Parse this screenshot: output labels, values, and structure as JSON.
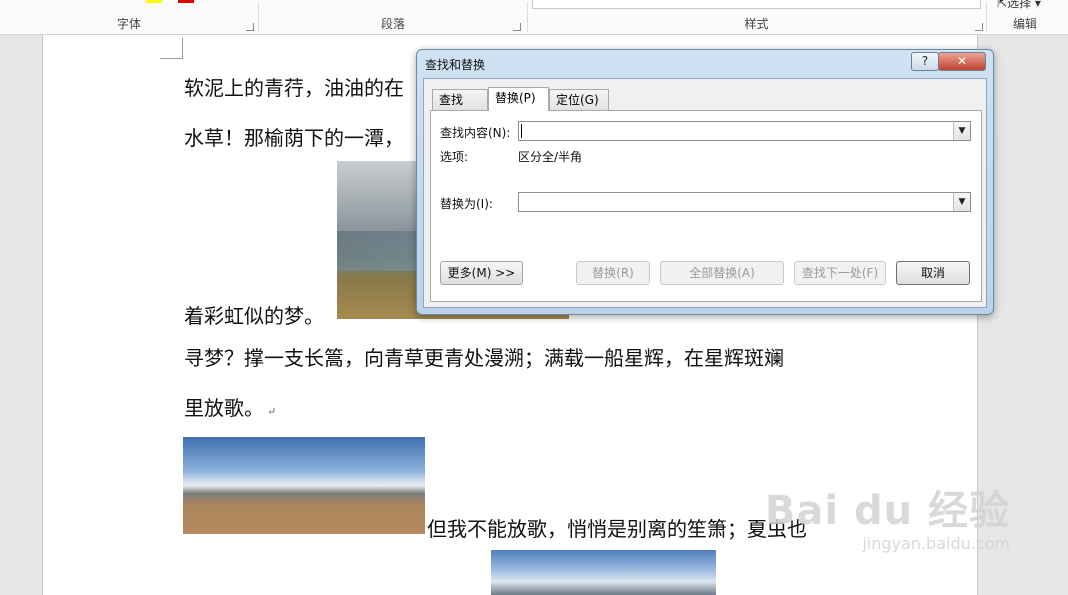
{
  "ribbon": {
    "groups": {
      "font": "字体",
      "paragraph": "段落",
      "styles": "样式",
      "editing": "编辑"
    },
    "select_label": "选择"
  },
  "document": {
    "line1": "软泥上的青荇，油油的在",
    "line2": "水草！那榆荫下的一潭，",
    "line3": "着彩虹似的梦。",
    "line4": "寻梦？撑一支长篙，向青草更青处漫溯；满载一船星辉，在星辉斑斓",
    "line5": "里放歌。",
    "line6": "但我不能放歌，悄悄是别离的笙箫；夏虫也",
    "paragraph_mark": "↵"
  },
  "dialog": {
    "title": "查找和替换",
    "help": "?",
    "close": "✕",
    "tabs": [
      "查找(D)",
      "替换(P)",
      "定位(G)"
    ],
    "active_tab": "替换(P)",
    "find_label": "查找内容(N):",
    "find_value": "",
    "options_label": "选项:",
    "options_value": "区分全/半角",
    "replace_label": "替换为(I):",
    "replace_value": "",
    "buttons": {
      "more": "更多(M) >>",
      "replace": "替换(R)",
      "replace_all": "全部替换(A)",
      "find_next": "查找下一处(F)",
      "cancel": "取消"
    }
  },
  "watermark": {
    "logo": "Bai du 经验",
    "url": "jingyan.baidu.com"
  }
}
